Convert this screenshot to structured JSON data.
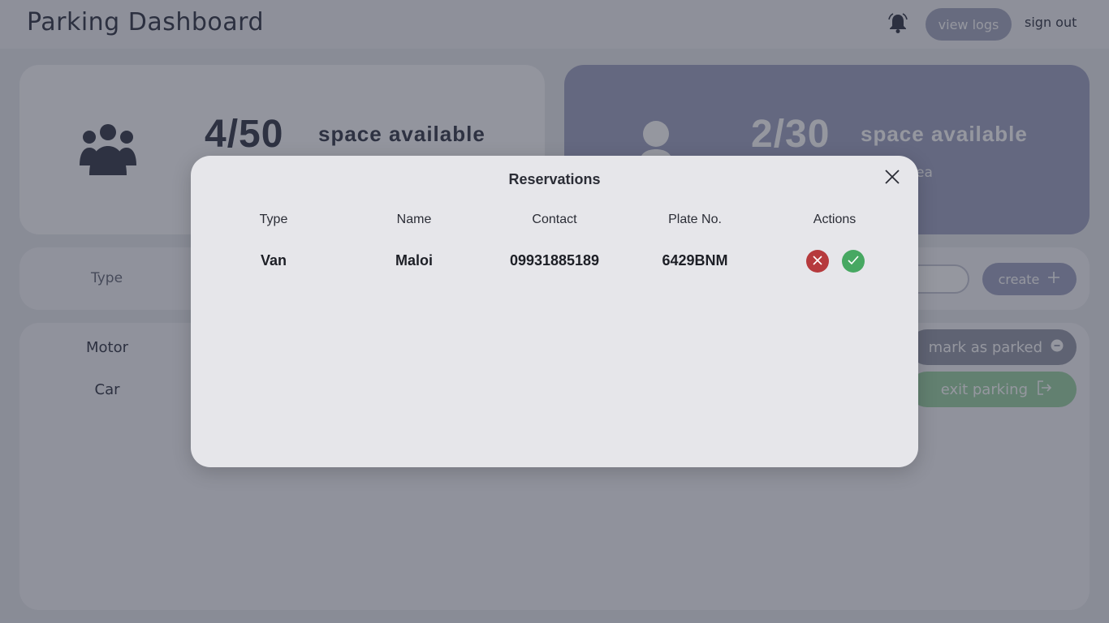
{
  "header": {
    "title": "Parking Dashboard",
    "view_logs_label": "view logs",
    "sign_out_label": "sign out"
  },
  "stats": {
    "left": {
      "count": "4/50",
      "label": "space available"
    },
    "right": {
      "count": "2/30",
      "label": "space available",
      "sub": "ea"
    }
  },
  "form": {
    "type_label": "Type",
    "create_label": "create",
    "create_icon": "plus-icon"
  },
  "list": {
    "items": [
      "Motor",
      "Car"
    ],
    "mark_parked_label": "mark as parked",
    "exit_parking_label": "exit parking"
  },
  "modal": {
    "title": "Reservations",
    "columns": [
      "Type",
      "Name",
      "Contact",
      "Plate No.",
      "Actions"
    ],
    "rows": [
      {
        "type": "Van",
        "name": "Maloi",
        "contact": "09931885189",
        "plate": "6429BNM"
      }
    ]
  },
  "colors": {
    "overlay": "#1e2234",
    "reject": "#b63a3d",
    "accept": "#47a862",
    "accent": "#a3a6c4"
  }
}
